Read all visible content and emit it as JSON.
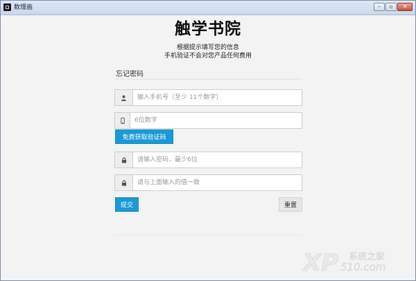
{
  "window": {
    "title": "数理画",
    "buttons": {
      "minimize": "–",
      "maximize": "▫",
      "close": "✕"
    }
  },
  "brand": {
    "name": "触学书院"
  },
  "subtitle": {
    "line1": "根据提示填写您的信息",
    "line2": "手机验证不会对您产品任何费用"
  },
  "form": {
    "title": "忘记密码",
    "phone": {
      "placeholder": "输入手机号（至少 11个数字）",
      "icon": "user-icon"
    },
    "code": {
      "placeholder": "6位数字",
      "icon": "phone-icon"
    },
    "get_code_label": "免费获取验证码",
    "password": {
      "placeholder": "请输入密码，最少6位",
      "icon": "lock-icon"
    },
    "confirm": {
      "placeholder": "请与上面输入的值一致",
      "icon": "lock-icon"
    },
    "submit_label": "提交",
    "reset_label": "重置"
  },
  "watermark": {
    "text": "系统之家",
    "site": "510.com"
  },
  "colors": {
    "primary": "#1a9ad6",
    "background": "#f3f3f3",
    "border": "#cfcfcf"
  }
}
